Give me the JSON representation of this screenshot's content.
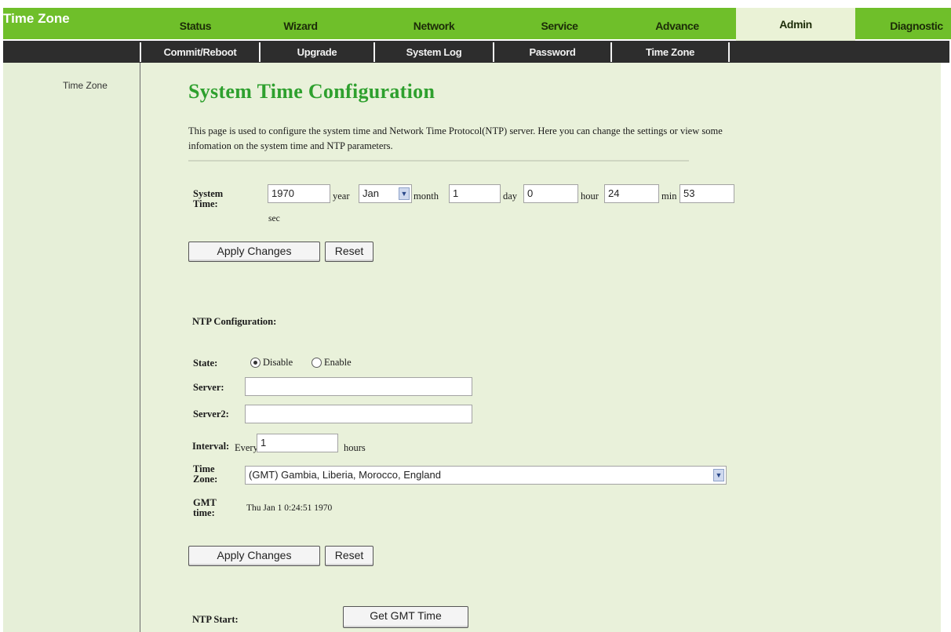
{
  "nav": {
    "brand": "Time Zone",
    "tabs": [
      "Status",
      "Wizard",
      "Network",
      "Service",
      "Advance",
      "Admin",
      "Diagnostic"
    ],
    "active_tab": "Admin"
  },
  "subnav": {
    "tabs": [
      "Commit/Reboot",
      "Upgrade",
      "System Log",
      "Password",
      "Time Zone"
    ]
  },
  "sidebar": {
    "items": [
      "Time Zone"
    ]
  },
  "page": {
    "title": "System Time Configuration",
    "description": "This page is used to configure the system time and Network Time Protocol(NTP) server. Here you can change the settings or view some infomation on the system time and NTP parameters."
  },
  "system_time": {
    "label": "System Time:",
    "year": "1970",
    "year_unit": "year",
    "month": "Jan",
    "month_unit": "month",
    "day": "1",
    "day_unit": "day",
    "hour": "0",
    "hour_unit": "hour",
    "min": "24",
    "min_unit": "min",
    "sec": "53",
    "sec_unit": "sec",
    "apply_label": "Apply Changes",
    "reset_label": "Reset"
  },
  "ntp": {
    "heading": "NTP Configuration:",
    "state_label": "State:",
    "state_options": [
      "Disable",
      "Enable"
    ],
    "state_selected": "Disable",
    "server_label": "Server:",
    "server_value": "",
    "server2_label": "Server2:",
    "server2_value": "",
    "interval_label": "Interval:",
    "interval_prefix": "Every",
    "interval_value": "1",
    "interval_unit": "hours",
    "timezone_label": "Time Zone:",
    "timezone_value": "(GMT) Gambia, Liberia, Morocco, England",
    "gmt_label": "GMT time:",
    "gmt_value": "Thu Jan 1 0:24:51 1970",
    "apply_label": "Apply Changes",
    "reset_label": "Reset",
    "start_label": "NTP Start:",
    "get_gmt_label": "Get GMT Time"
  }
}
